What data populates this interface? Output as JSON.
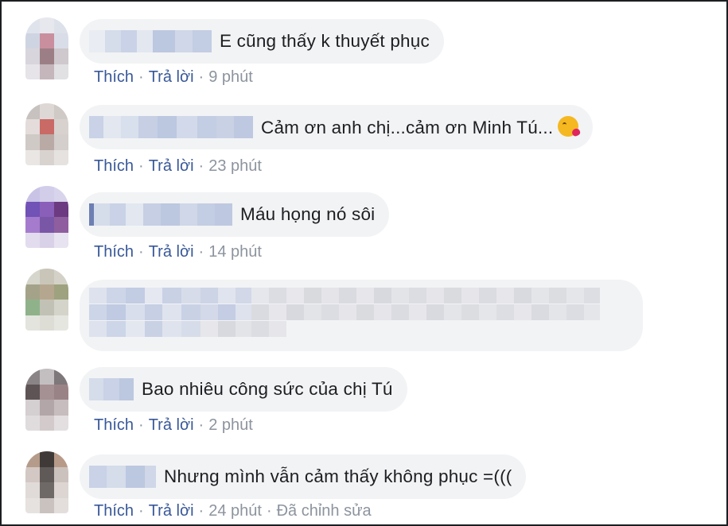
{
  "comments": [
    {
      "text": "E cũng thấy k thuyết phục",
      "actions": {
        "like": "Thích",
        "reply": "Trả lời",
        "time": "9 phút",
        "edited": ""
      }
    },
    {
      "text": "Cảm ơn anh chị...cảm ơn Minh Tú...",
      "emoji": "kissing-face-emoji",
      "actions": {
        "like": "Thích",
        "reply": "Trả lời",
        "time": "23 phút",
        "edited": ""
      }
    },
    {
      "text": "Máu họng nó sôi",
      "actions": {
        "like": "Thích",
        "reply": "Trả lời",
        "time": "14 phút",
        "edited": ""
      }
    },
    {
      "text": "",
      "blurred": true
    },
    {
      "text": "Bao nhiêu công sức của chị Tú",
      "actions": {
        "like": "Thích",
        "reply": "Trả lời",
        "time": "2 phút",
        "edited": ""
      }
    },
    {
      "text": "Nhưng mình vẫn cảm thấy không phục =(((",
      "actions": {
        "like": "Thích",
        "reply": "Trả lời",
        "time": "24 phút",
        "edited": "Đã chỉnh sửa"
      }
    }
  ],
  "separator": "·",
  "colors": {
    "link": "#385898",
    "meta": "#8d949e",
    "bubble": "#f2f3f5",
    "text": "#1c1e21"
  }
}
